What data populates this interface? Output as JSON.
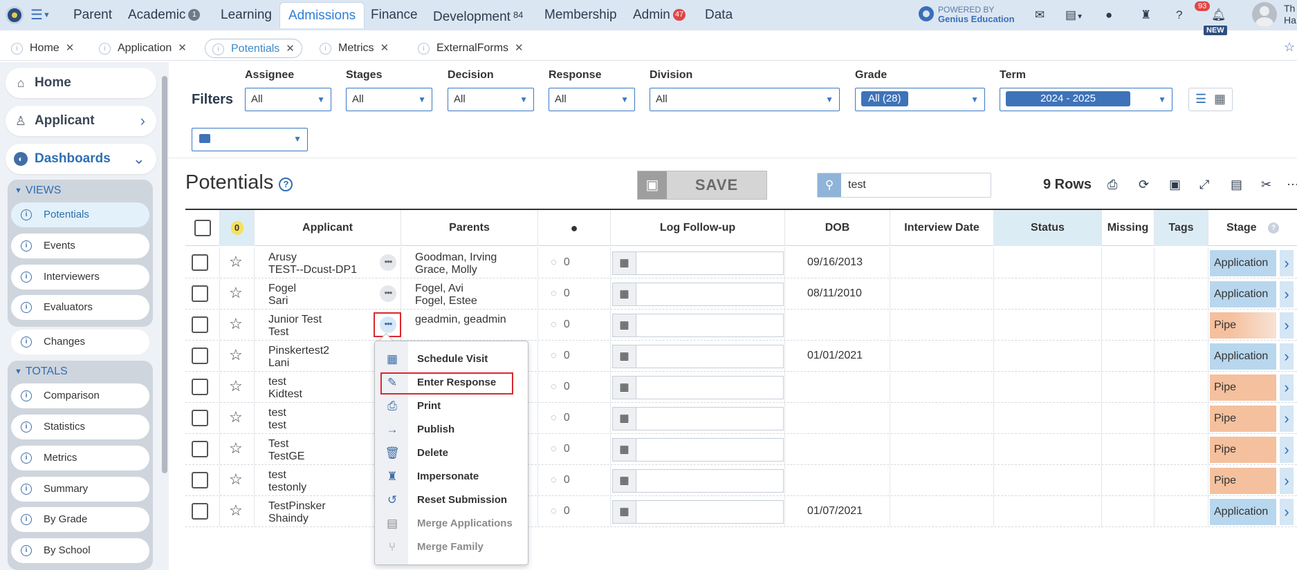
{
  "topnav": {
    "items": [
      {
        "label": "Parent"
      },
      {
        "label": "Academic",
        "badge": "1"
      },
      {
        "label": "Learning"
      },
      {
        "label": "Admissions"
      },
      {
        "label": "Finance"
      },
      {
        "label": "Development",
        "badge": "84"
      },
      {
        "label": "Membership"
      },
      {
        "label": "Admin",
        "badge": "47"
      },
      {
        "label": "Data"
      }
    ],
    "powered_by": "POWERED BY",
    "powered_brand": "Genius Education",
    "notification_count": "93",
    "new_tag": "NEW",
    "user_initials": "Th\nHa"
  },
  "tabs": [
    {
      "label": "Home"
    },
    {
      "label": "Application"
    },
    {
      "label": "Potentials"
    },
    {
      "label": "Metrics"
    },
    {
      "label": "ExternalForms"
    }
  ],
  "sidebar": {
    "home": "Home",
    "applicant": "Applicant",
    "dashboards": "Dashboards",
    "views_title": "VIEWS",
    "views": [
      "Potentials",
      "Events",
      "Interviewers",
      "Evaluators",
      "Changes"
    ],
    "totals_title": "TOTALS",
    "totals": [
      "Comparison",
      "Statistics",
      "Metrics",
      "Summary",
      "By Grade",
      "By School"
    ]
  },
  "filters": {
    "label": "Filters",
    "assignee": {
      "label": "Assignee",
      "value": "All"
    },
    "stages": {
      "label": "Stages",
      "value": "All"
    },
    "decision": {
      "label": "Decision",
      "value": "All"
    },
    "response": {
      "label": "Response",
      "value": "All"
    },
    "division": {
      "label": "Division",
      "value": "All"
    },
    "grade": {
      "label": "Grade",
      "value": "All (28)"
    },
    "term": {
      "label": "Term",
      "value": "2024 - 2025"
    }
  },
  "main": {
    "title": "Potentials",
    "save_label": "SAVE",
    "search_value": "test",
    "rows_count": "9 Rows"
  },
  "table": {
    "headers": {
      "flag_count": "0",
      "applicant": "Applicant",
      "parents": "Parents",
      "log_followup": "Log Follow-up",
      "dob": "DOB",
      "interview_date": "Interview Date",
      "status": "Status",
      "missing": "Missing",
      "tags": "Tags",
      "stage": "Stage"
    },
    "rows": [
      {
        "last": "Arusy",
        "first": "TEST--Dcust-DP1",
        "parent1": "Goodman, Irving",
        "parent2": "Grace, Molly",
        "comments": "0",
        "dob": "09/16/2013",
        "stage": "Application"
      },
      {
        "last": "Fogel",
        "first": "Sari",
        "parent1": "Fogel, Avi",
        "parent2": "Fogel, Estee",
        "comments": "0",
        "dob": "08/11/2010",
        "stage": "Application"
      },
      {
        "last": "Junior Test",
        "first": "Test",
        "parent1": "geadmin, geadmin",
        "parent2": "",
        "comments": "0",
        "dob": "",
        "stage": "Pipe"
      },
      {
        "last": "Pinskertest2",
        "first": "Lani",
        "parent1": "",
        "parent2": "",
        "comments": "0",
        "dob": "01/01/2021",
        "stage": "Application"
      },
      {
        "last": "test",
        "first": "Kidtest",
        "parent1": "",
        "parent2": "",
        "comments": "0",
        "dob": "",
        "stage": "Pipe"
      },
      {
        "last": "test",
        "first": "test",
        "parent1": "",
        "parent2": "",
        "comments": "0",
        "dob": "",
        "stage": "Pipe"
      },
      {
        "last": "Test",
        "first": "TestGE",
        "parent1": "",
        "parent2": "",
        "comments": "0",
        "dob": "",
        "stage": "Pipe"
      },
      {
        "last": "test",
        "first": "testonly",
        "parent1": "",
        "parent2": "",
        "comments": "0",
        "dob": "",
        "stage": "Pipe"
      },
      {
        "last": "TestPinsker",
        "first": "Shaindy",
        "parent1": "",
        "parent2": "",
        "comments": "0",
        "dob": "01/07/2021",
        "stage": "Application"
      }
    ]
  },
  "context_menu": {
    "items": [
      {
        "label": "Schedule Visit",
        "icon": "calendar-icon",
        "enabled": true
      },
      {
        "label": "Enter Response",
        "icon": "pencil-icon",
        "enabled": true
      },
      {
        "label": "Print",
        "icon": "printer-icon",
        "enabled": true
      },
      {
        "label": "Publish",
        "icon": "arrow-right-icon",
        "enabled": true
      },
      {
        "label": "Delete",
        "icon": "trash-icon",
        "enabled": true
      },
      {
        "label": "Impersonate",
        "icon": "incognito-icon",
        "enabled": true
      },
      {
        "label": "Reset Submission",
        "icon": "undo-icon",
        "enabled": true
      },
      {
        "label": "Merge Applications",
        "icon": "document-icon",
        "enabled": false
      },
      {
        "label": "Merge Family",
        "icon": "branch-icon",
        "enabled": false
      }
    ]
  },
  "colors": {
    "accent": "#2e6fb4",
    "nav_bg": "#dbe6f3",
    "stage_application": "#b8d7ee",
    "stage_pipe": "#f5c09d",
    "highlight_box": "#d9282f"
  }
}
